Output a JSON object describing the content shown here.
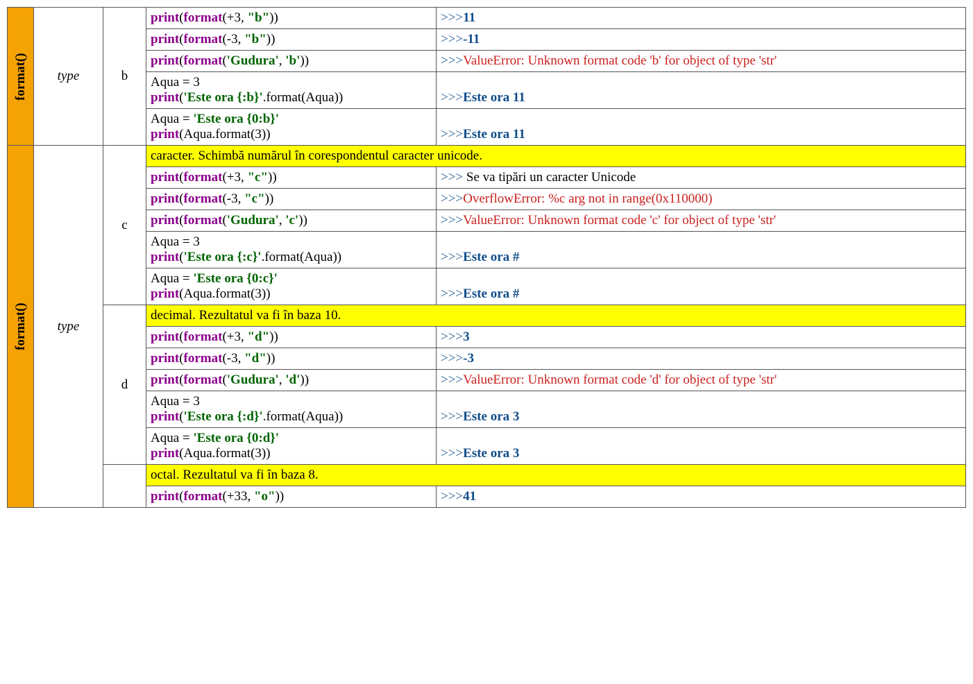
{
  "labels": {
    "format_fn": "format()",
    "type": "type"
  },
  "groups": [
    {
      "letter": "b",
      "desc": null,
      "rows": [
        {
          "code_html": "<span class='kw'>print</span>(<span class='fn'>format</span>(+3, <span class='s'>\"b\"</span>))",
          "out_html": "<span class='prompt'>&gt;&gt;&gt;</span><span class='ok'>11</span>"
        },
        {
          "code_html": "<span class='kw'>print</span>(<span class='fn'>format</span>(-3, <span class='s'>\"b\"</span>))",
          "out_html": "<span class='prompt'>&gt;&gt;&gt;</span><span class='ok'>-11</span>"
        },
        {
          "code_html": "<span class='kw'>print</span>(<span class='fn'>format</span>(<span class='s'>'Gudura'</span>, <span class='s'>'b'</span>))",
          "out_html": "<span class='prompt'>&gt;&gt;&gt;</span><span class='err'>ValueError: Unknown format code 'b' for object of type 'str'</span>"
        },
        {
          "code_html": "<span class='plain'>Aqua = 3</span><br><span class='kw'>print</span>(<span class='s'>'Este ora {:b}'</span>.format(Aqua))",
          "out_html": "<span class='prompt'>&gt;&gt;&gt;</span><span class='ok'>Este ora 11</span>"
        },
        {
          "code_html": "<span class='plain'>Aqua = </span><span class='s'>'Este ora {0:b}'</span><br><span class='kw'>print</span>(Aqua.format(3))",
          "out_html": "<span class='prompt'>&gt;&gt;&gt;</span><span class='ok'>Este ora 11</span>"
        }
      ]
    },
    {
      "letter": "c",
      "desc": "caracter. Schimbă numărul în corespondentul caracter unicode.",
      "rows": [
        {
          "code_html": "<span class='kw'>print</span>(<span class='fn'>format</span>(+3, <span class='s'>\"c\"</span>))",
          "out_html": "<span class='prompt'>&gt;&gt;&gt;</span><span class='plain'> Se va tipări un caracter Unicode</span>"
        },
        {
          "code_html": "<span class='kw'>print</span>(<span class='fn'>format</span>(-3, <span class='s'>\"c\"</span>))",
          "out_html": "<span class='prompt'>&gt;&gt;&gt;</span><span class='err'>OverflowError: %c arg not in range(0x110000)</span>"
        },
        {
          "code_html": "<span class='kw'>print</span>(<span class='fn'>format</span>(<span class='s'>'Gudura'</span>, <span class='s'>'c'</span>))",
          "out_html": "<span class='prompt'>&gt;&gt;&gt;</span><span class='err'>ValueError: Unknown format code 'c' for object of type 'str'</span>"
        },
        {
          "code_html": "<span class='plain'>Aqua = 3</span><br><span class='kw'>print</span>(<span class='s'>'Este ora {:c}'</span>.format(Aqua))",
          "out_html": "<span class='prompt'>&gt;&gt;&gt;</span><span class='ok'>Este ora #</span>"
        },
        {
          "code_html": "<span class='plain'>Aqua = </span><span class='s'>'Este ora {0:c}'</span><br><span class='kw'>print</span>(Aqua.format(3))",
          "out_html": "<span class='prompt'>&gt;&gt;&gt;</span><span class='ok'>Este ora #</span>"
        }
      ]
    },
    {
      "letter": "d",
      "desc": "decimal. Rezultatul va fi în baza 10.",
      "rows": [
        {
          "code_html": "<span class='kw'>print</span>(<span class='fn'>format</span>(+3, <span class='s'>\"d\"</span>))",
          "out_html": "<span class='prompt'>&gt;&gt;&gt;</span><span class='ok'>3</span>"
        },
        {
          "code_html": "<span class='kw'>print</span>(<span class='fn'>format</span>(-3, <span class='s'>\"d\"</span>))",
          "out_html": "<span class='prompt'>&gt;&gt;&gt;</span><span class='ok'>-3</span>"
        },
        {
          "code_html": "<span class='kw'>print</span>(<span class='fn'>format</span>(<span class='s'>'Gudura'</span>, <span class='s'>'d'</span>))",
          "out_html": "<span class='prompt'>&gt;&gt;&gt;</span><span class='err'>ValueError: Unknown format code 'd' for object of type 'str'</span>"
        },
        {
          "code_html": "<span class='plain'>Aqua = 3</span><br><span class='kw'>print</span>(<span class='s'>'Este ora {:d}'</span>.format(Aqua))",
          "out_html": "<span class='prompt'>&gt;&gt;&gt;</span><span class='ok'>Este ora 3</span>"
        },
        {
          "code_html": "<span class='plain'>Aqua = </span><span class='s'>'Este ora {0:d}'</span><br><span class='kw'>print</span>(Aqua.format(3))",
          "out_html": "<span class='prompt'>&gt;&gt;&gt;</span><span class='ok'>Este ora 3</span>"
        }
      ]
    },
    {
      "letter": "",
      "desc": "octal. Rezultatul va fi în baza 8.",
      "rows": [
        {
          "code_html": "<span class='kw'>print</span>(<span class='fn'>format</span>(+33, <span class='s'>\"o\"</span>))",
          "out_html": "<span class='prompt'>&gt;&gt;&gt;</span><span class='ok'>41</span>"
        }
      ]
    }
  ]
}
